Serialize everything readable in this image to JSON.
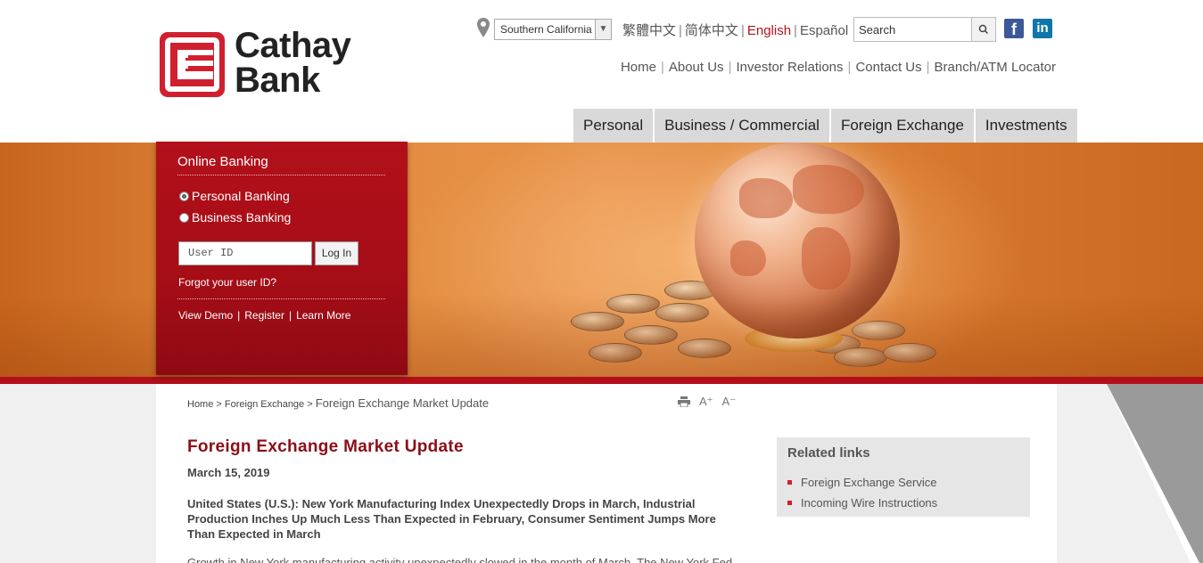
{
  "brand": {
    "name_line1": "Cathay",
    "name_line2": "Bank",
    "accent": "#d0202f"
  },
  "header": {
    "region": "Southern California",
    "languages": [
      {
        "label": "繁體中文",
        "active": false
      },
      {
        "label": "简体中文",
        "active": false
      },
      {
        "label": "English",
        "active": true
      },
      {
        "label": "Español",
        "active": false
      }
    ],
    "search_placeholder": "Search",
    "social": {
      "facebook": "f",
      "linkedin": "in"
    },
    "top_links": [
      "Home",
      "About Us",
      "Investor Relations",
      "Contact Us",
      "Branch/ATM Locator"
    ],
    "main_nav": [
      "Personal",
      "Business / Commercial",
      "Foreign Exchange",
      "Investments"
    ]
  },
  "login": {
    "title": "Online Banking",
    "options": [
      "Personal Banking",
      "Business Banking"
    ],
    "selected_option": "Personal Banking",
    "user_placeholder": "User ID",
    "login_label": "Log In",
    "forgot": "Forgot your user ID?",
    "links": [
      "View Demo",
      "Register",
      "Learn More"
    ]
  },
  "breadcrumb": {
    "items": [
      "Home",
      "Foreign Exchange"
    ],
    "current": "Foreign Exchange Market Update"
  },
  "tools": {
    "increase": "A⁺",
    "decrease": "A⁻"
  },
  "article": {
    "title": "Foreign Exchange Market Update",
    "date": "March 15, 2019",
    "lead": "United States (U.S.): New York Manufacturing Index Unexpectedly Drops in March, Industrial Production Inches Up Much Less Than Expected in February, Consumer Sentiment Jumps More Than Expected in March",
    "body_start": "Growth in New York manufacturing activity unexpectedly slowed in the month of March. The New York Fed"
  },
  "related": {
    "title": "Related links",
    "links": [
      "Foreign Exchange Service",
      "Incoming Wire Instructions"
    ]
  }
}
